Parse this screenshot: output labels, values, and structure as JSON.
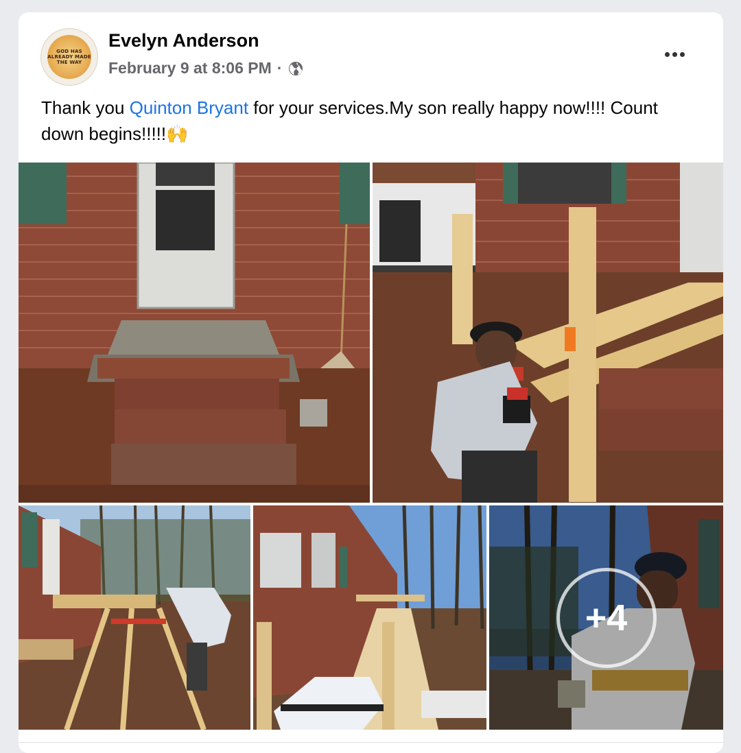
{
  "post": {
    "author": "Evelyn Anderson",
    "timestamp": "February 9 at 8:06 PM",
    "separator": "·",
    "audience_icon": "globe-icon",
    "more_icon": "more-options-icon",
    "text_before": "Thank you ",
    "mention": "Quinton Bryant",
    "text_after": " for your services.My son really happy now!!!! Count down begins!!!!!🙌"
  },
  "avatar": {
    "lines": [
      "GOD HAS",
      "ALREADY MADE",
      "THE WAY"
    ]
  },
  "photos": {
    "items": [
      {
        "name": "brick-steps-before"
      },
      {
        "name": "worker-building-frame"
      },
      {
        "name": "ramp-frame-side"
      },
      {
        "name": "ramp-decking-in-progress"
      },
      {
        "name": "worker-closeup"
      }
    ],
    "more_count": "+4"
  },
  "colors": {
    "link": "#1b74e4",
    "meta": "#65676b",
    "text": "#050505",
    "background": "#e9ebee"
  }
}
